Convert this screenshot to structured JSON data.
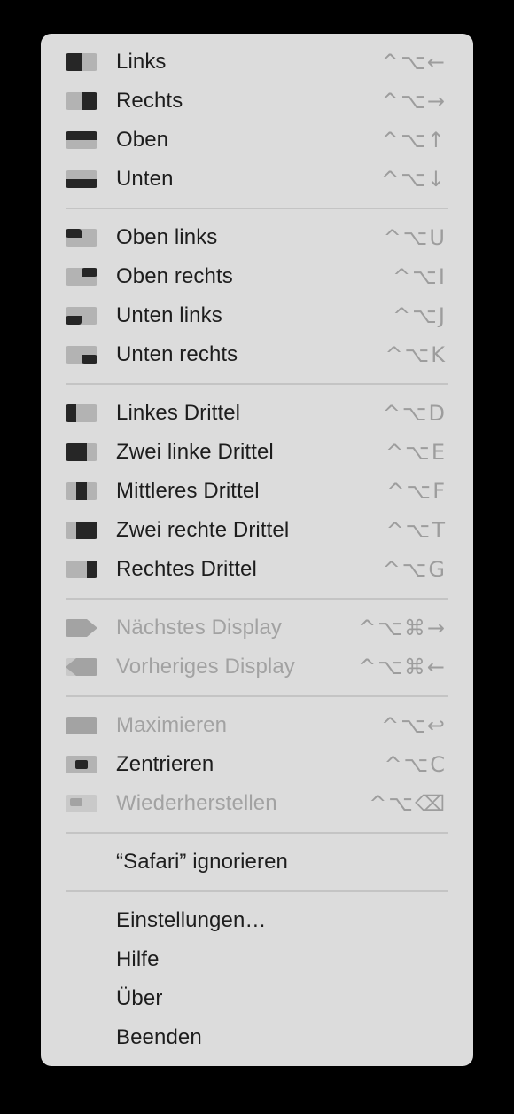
{
  "menu": {
    "groups": [
      [
        {
          "label": "Links",
          "shortcut": "^⌥←",
          "icon": "half-left-icon",
          "enabled": true
        },
        {
          "label": "Rechts",
          "shortcut": "^⌥→",
          "icon": "half-right-icon",
          "enabled": true
        },
        {
          "label": "Oben",
          "shortcut": "^⌥↑",
          "icon": "half-top-icon",
          "enabled": true
        },
        {
          "label": "Unten",
          "shortcut": "^⌥↓",
          "icon": "half-bottom-icon",
          "enabled": true
        }
      ],
      [
        {
          "label": "Oben links",
          "shortcut": "^⌥U",
          "icon": "top-left-quarter-icon",
          "enabled": true
        },
        {
          "label": "Oben rechts",
          "shortcut": "^⌥I",
          "icon": "top-right-quarter-icon",
          "enabled": true
        },
        {
          "label": "Unten links",
          "shortcut": "^⌥J",
          "icon": "bottom-left-quarter-icon",
          "enabled": true
        },
        {
          "label": "Unten rechts",
          "shortcut": "^⌥K",
          "icon": "bottom-right-quarter-icon",
          "enabled": true
        }
      ],
      [
        {
          "label": "Linkes Drittel",
          "shortcut": "^⌥D",
          "icon": "left-third-icon",
          "enabled": true
        },
        {
          "label": "Zwei linke Drittel",
          "shortcut": "^⌥E",
          "icon": "left-two-thirds-icon",
          "enabled": true
        },
        {
          "label": "Mittleres Drittel",
          "shortcut": "^⌥F",
          "icon": "center-third-icon",
          "enabled": true
        },
        {
          "label": "Zwei rechte Drittel",
          "shortcut": "^⌥T",
          "icon": "right-two-thirds-icon",
          "enabled": true
        },
        {
          "label": "Rechtes Drittel",
          "shortcut": "^⌥G",
          "icon": "right-third-icon",
          "enabled": true
        }
      ],
      [
        {
          "label": "Nächstes Display",
          "shortcut": "^⌥⌘→",
          "icon": "next-display-icon",
          "enabled": false
        },
        {
          "label": "Vorheriges Display",
          "shortcut": "^⌥⌘←",
          "icon": "previous-display-icon",
          "enabled": false
        }
      ],
      [
        {
          "label": "Maximieren",
          "shortcut": "^⌥↩",
          "icon": "maximize-icon",
          "enabled": false
        },
        {
          "label": "Zentrieren",
          "shortcut": "^⌥C",
          "icon": "center-icon",
          "enabled": true
        },
        {
          "label": "Wiederherstellen",
          "shortcut": "^⌥⌫",
          "icon": "restore-icon",
          "enabled": false
        }
      ],
      [
        {
          "label": "“Safari” ignorieren",
          "shortcut": "",
          "icon": "",
          "enabled": true
        }
      ],
      [
        {
          "label": "Einstellungen…",
          "shortcut": "",
          "icon": "",
          "enabled": true
        },
        {
          "label": "Hilfe",
          "shortcut": "",
          "icon": "",
          "enabled": true
        },
        {
          "label": "Über",
          "shortcut": "",
          "icon": "",
          "enabled": true
        },
        {
          "label": "Beenden",
          "shortcut": "",
          "icon": "",
          "enabled": true
        }
      ]
    ]
  },
  "colors": {
    "menu_background": "#dcdcdc",
    "icon_dark": "#262626",
    "icon_light": "#b3b3b3",
    "icon_disabled": "#a3a3a3",
    "text": "#1d1d1d",
    "text_disabled": "#a2a2a2",
    "shortcut": "#9d9d9d",
    "separator": "#c4c4c4"
  }
}
